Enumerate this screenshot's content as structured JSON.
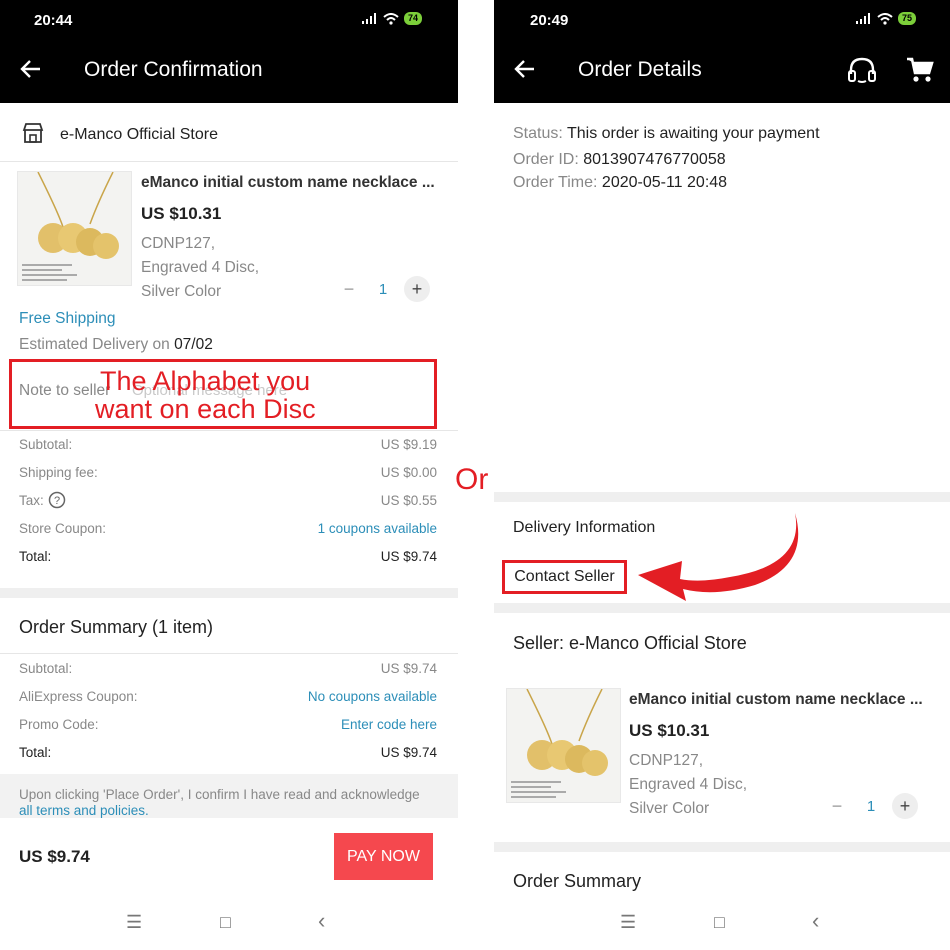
{
  "left": {
    "status": {
      "time": "20:44",
      "battery": "74"
    },
    "header": {
      "title": "Order Confirmation"
    },
    "store": {
      "name": "e-Manco Official Store",
      "icon": "store-icon"
    },
    "product": {
      "name": "eManco initial custom name necklace ...",
      "price": "US $10.31",
      "variant": [
        "CDNP127,",
        "Engraved 4 Disc,",
        "Silver Color"
      ],
      "qty_minus": "−",
      "quantity": "1",
      "qty_plus": "+"
    },
    "shipping": {
      "free": "Free Shipping",
      "delivery_prefix": "Estimated Delivery on ",
      "delivery_date": "07/02"
    },
    "note": {
      "label": "Note to seller",
      "placeholder": "Optional message here"
    },
    "annotation": {
      "line1": "The Alphabet you",
      "line2": "want on each Disc"
    },
    "costs": [
      {
        "label": "Subtotal:",
        "value": "US $9.19"
      },
      {
        "label": "Shipping fee:",
        "value": "US $0.00"
      },
      {
        "label": "Tax:",
        "value": "US $0.55"
      },
      {
        "label": "Store Coupon:",
        "value": "1 coupons available"
      },
      {
        "label": "Total:",
        "value": "US $9.74"
      }
    ],
    "summary": {
      "title": "Order Summary (1 item)",
      "rows": [
        {
          "label": "Subtotal:",
          "value": "US $9.74"
        },
        {
          "label": "AliExpress Coupon:",
          "value": "No coupons available"
        },
        {
          "label": "Promo Code:",
          "value": "Enter code here"
        },
        {
          "label": "Total:",
          "value": "US $9.74"
        }
      ]
    },
    "terms": {
      "text": "Upon clicking 'Place Order', I confirm I have read and acknowledge",
      "link": "all terms and policies."
    },
    "footer": {
      "total": "US $9.74",
      "pay": "PAY NOW"
    }
  },
  "or_label": "Or",
  "right": {
    "status": {
      "time": "20:49",
      "battery": "75"
    },
    "header": {
      "title": "Order Details"
    },
    "order": {
      "status_label": "Status:",
      "status_value": "This order is awaiting your payment",
      "id_label": "Order ID:",
      "id_value": "8013907476770058",
      "time_label": "Order Time:",
      "time_value": "2020-05-11 20:48"
    },
    "delivery": {
      "title": "Delivery Information",
      "contact": "Contact Seller"
    },
    "seller": {
      "label": "Seller: e-Manco Official Store"
    },
    "product": {
      "name": "eManco initial custom name necklace ...",
      "price": "US $10.31",
      "variant": [
        "CDNP127,",
        "Engraved 4 Disc,",
        "Silver Color"
      ],
      "qty_minus": "−",
      "quantity": "1",
      "qty_plus": "+"
    },
    "summary": {
      "title": "Order Summary"
    }
  },
  "nav": {
    "recent": "☰",
    "home": "□",
    "back": "‹"
  },
  "colors": {
    "accent_red": "#e31e24",
    "link_blue": "#2c8eb8",
    "pay_button": "#f5484e",
    "header_bg": "#000000"
  }
}
